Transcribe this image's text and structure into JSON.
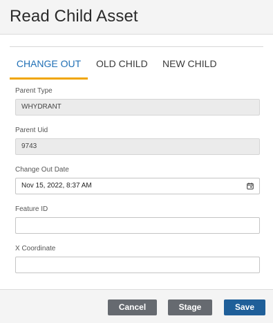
{
  "dialog": {
    "title": "Read Child Asset"
  },
  "tabs": [
    {
      "label": "CHANGE OUT",
      "active": true
    },
    {
      "label": "OLD CHILD",
      "active": false
    },
    {
      "label": "NEW CHILD",
      "active": false
    }
  ],
  "fields": {
    "parent_type": {
      "label": "Parent Type",
      "value": "WHYDRANT"
    },
    "parent_uid": {
      "label": "Parent Uid",
      "value": "9743"
    },
    "change_out_date": {
      "label": "Change Out Date",
      "value": "Nov 15, 2022, 8:37 AM",
      "icon": "calendar-icon"
    },
    "feature_id": {
      "label": "Feature ID",
      "value": ""
    },
    "x_coordinate": {
      "label": "X Coordinate",
      "value": ""
    }
  },
  "footer": {
    "cancel_label": "Cancel",
    "stage_label": "Stage",
    "save_label": "Save"
  },
  "colors": {
    "accent_tab": "#1f6fb5",
    "tab_underline": "#f0a500",
    "save_button": "#1f5f99",
    "secondary_button": "#666a70"
  }
}
